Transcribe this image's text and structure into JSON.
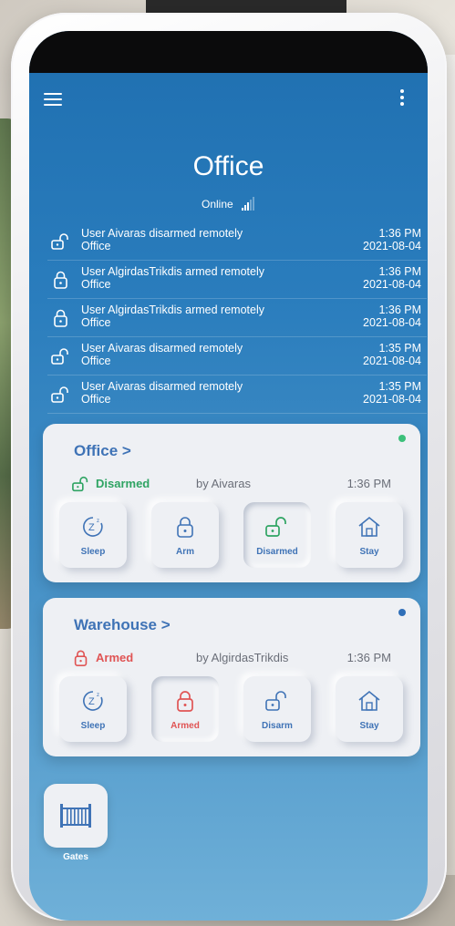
{
  "header": {
    "title": "Office",
    "status": "Online"
  },
  "events": [
    {
      "icon": "unlocked-icon",
      "text": "User Aivaras disarmed remotely",
      "location": "Office",
      "time": "1:36 PM",
      "date": "2021-08-04"
    },
    {
      "icon": "locked-icon",
      "text": "User AlgirdasTrikdis armed remotely",
      "location": "Office",
      "time": "1:36 PM",
      "date": "2021-08-04"
    },
    {
      "icon": "locked-icon",
      "text": "User AlgirdasTrikdis armed remotely",
      "location": "Office",
      "time": "1:36 PM",
      "date": "2021-08-04"
    },
    {
      "icon": "unlocked-icon",
      "text": "User Aivaras disarmed remotely",
      "location": "Office",
      "time": "1:35 PM",
      "date": "2021-08-04"
    },
    {
      "icon": "unlocked-icon",
      "text": "User Aivaras disarmed remotely",
      "location": "Office",
      "time": "1:35 PM",
      "date": "2021-08-04"
    }
  ],
  "areas": [
    {
      "name": "Office >",
      "status_dot_color": "#3cc07a",
      "state": "Disarmed",
      "state_color": "#2fa463",
      "by": "by Aivaras",
      "time": "1:36 PM",
      "buttons": {
        "sleep": "Sleep",
        "arm": "Arm",
        "disarm": "Disarmed",
        "stay": "Stay"
      }
    },
    {
      "name": "Warehouse >",
      "status_dot_color": "#2f6fb8",
      "state": "Armed",
      "state_color": "#e05454",
      "by": "by AlgirdasTrikdis",
      "time": "1:36 PM",
      "buttons": {
        "sleep": "Sleep",
        "arm": "Armed",
        "disarm": "Disarm",
        "stay": "Stay"
      }
    }
  ],
  "shortcuts": {
    "gates": "Gates"
  },
  "colors": {
    "accent": "#3f73b6",
    "armed": "#e05454",
    "disarmed": "#2fa463"
  }
}
